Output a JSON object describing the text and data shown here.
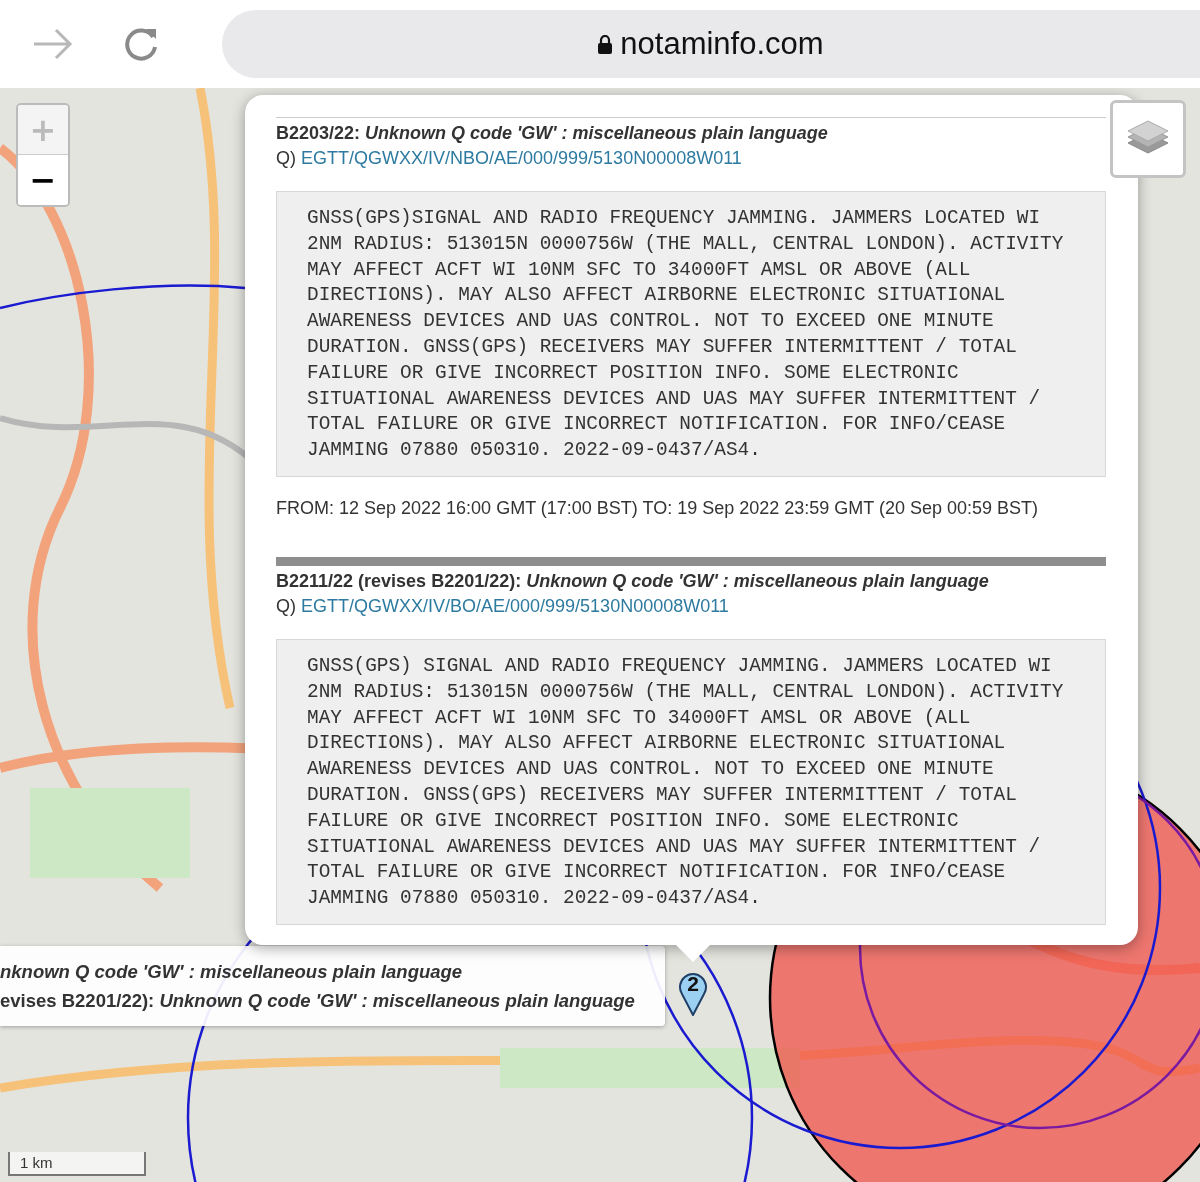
{
  "browser": {
    "address": "notaminfo.com",
    "forward_disabled": true
  },
  "map": {
    "zoom_in": "+",
    "zoom_out": "−",
    "scale": "1 km",
    "marker_count": "2"
  },
  "popup": {
    "notams": [
      {
        "title": "B2203/22: *Unknown Q code 'GW' : miscellaneous plain language*",
        "q_prefix": "Q)",
        "q_link": "EGTT/QGWXX/IV/NBO/AE/000/999/5130N00008W011",
        "text": "GNSS(GPS)SIGNAL AND RADIO FREQUENCY JAMMING. JAMMERS LOCATED WI\n2NM RADIUS: 513015N 0000756W (THE MALL, CENTRAL LONDON). ACTIVITY\nMAY AFFECT ACFT WI 10NM SFC TO 34000FT AMSL OR ABOVE (ALL\nDIRECTIONS). MAY ALSO AFFECT AIRBORNE ELECTRONIC SITUATIONAL\nAWARENESS DEVICES AND UAS CONTROL. NOT TO EXCEED ONE MINUTE\nDURATION. GNSS(GPS) RECEIVERS MAY SUFFER INTERMITTENT / TOTAL\nFAILURE OR GIVE INCORRECT POSITION INFO. SOME ELECTRONIC\nSITUATIONAL AWARENESS DEVICES AND UAS MAY SUFFER INTERMITTENT /\nTOTAL FAILURE OR GIVE INCORRECT NOTIFICATION. FOR INFO/CEASE\nJAMMING 07880 050310. 2022-09-0437/AS4.",
        "validity": "FROM: 12 Sep 2022 16:00 GMT (17:00 BST) TO: 19 Sep 2022 23:59 GMT (20 Sep 00:59 BST)"
      },
      {
        "title": "B2211/22 (revises B2201/22): *Unknown Q code 'GW' : miscellaneous plain language*",
        "q_prefix": "Q)",
        "q_link": "EGTT/QGWXX/IV/BO/AE/000/999/5130N00008W011",
        "text": "GNSS(GPS) SIGNAL AND RADIO FREQUENCY JAMMING. JAMMERS LOCATED WI\n2NM RADIUS: 513015N 0000756W (THE MALL, CENTRAL LONDON). ACTIVITY\nMAY AFFECT ACFT WI 10NM SFC TO 34000FT AMSL OR ABOVE (ALL\nDIRECTIONS). MAY ALSO AFFECT AIRBORNE ELECTRONIC SITUATIONAL\nAWARENESS DEVICES AND UAS CONTROL. NOT TO EXCEED ONE MINUTE\nDURATION. GNSS(GPS) RECEIVERS MAY SUFFER INTERMITTENT / TOTAL\nFAILURE OR GIVE INCORRECT POSITION INFO. SOME ELECTRONIC\nSITUATIONAL AWARENESS DEVICES AND UAS MAY SUFFER INTERMITTENT /\nTOTAL FAILURE OR GIVE INCORRECT NOTIFICATION. FOR INFO/CEASE\nJAMMING 07880 050310. 2022-09-0437/AS4."
      }
    ]
  },
  "tooltip": {
    "lines": [
      "*nknown Q code 'GW' : miscellaneous plain language*",
      "evises B2201/22): *Unknown Q code 'GW' : miscellaneous plain language*"
    ]
  }
}
